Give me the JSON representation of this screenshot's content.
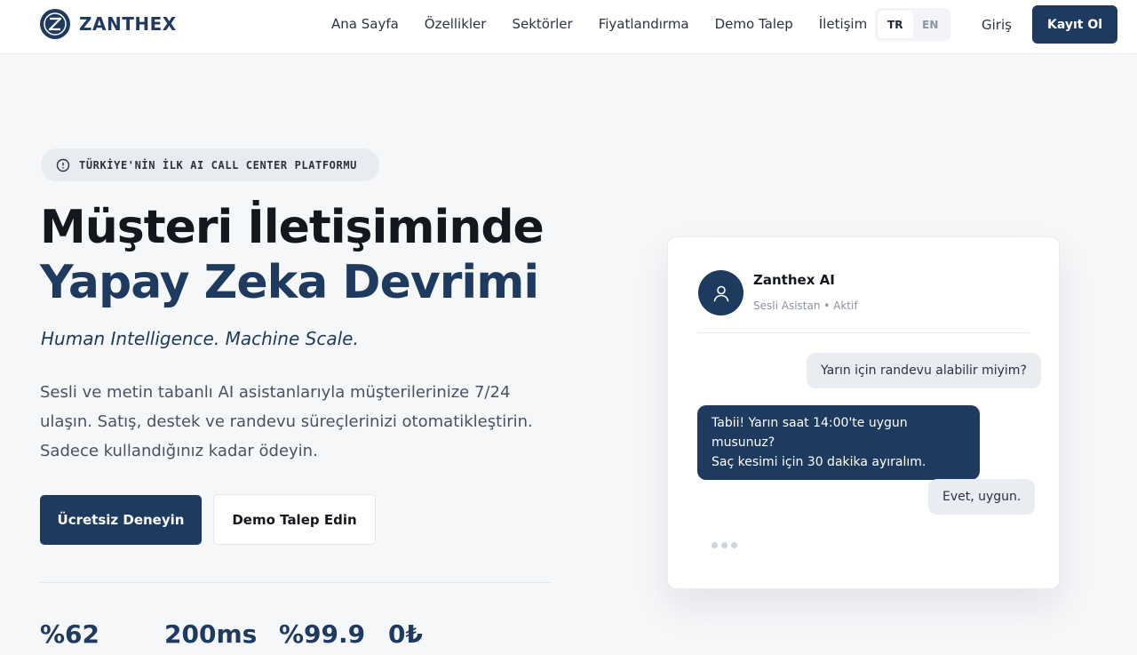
{
  "header": {
    "brand": "ZANTHEX",
    "nav": [
      "Ana Sayfa",
      "Özellikler",
      "Sektörler",
      "Fiyatlandırma",
      "Demo Talep",
      "İletişim"
    ],
    "lang": {
      "active": "TR",
      "inactive": "EN"
    },
    "login": "Giriş",
    "signup": "Kayıt Ol"
  },
  "hero": {
    "badge": "TÜRKİYE'NİN İLK AI CALL CENTER PLATFORMU",
    "title_line1": "Müşteri İletişiminde",
    "title_line2": "Yapay Zeka Devrimi",
    "tagline": "Human Intelligence. Machine Scale.",
    "description_lines": [
      "Sesli ve metin tabanlı AI asistanlarıyla müşterilerinize 7/24",
      "ulaşın. Satış, destek ve randevu süreçlerinizi otomatikleştirin.",
      "Sadece kullandığınız kadar ödeyin."
    ],
    "cta_primary": "Ücretsiz Deneyin",
    "cta_secondary": "Demo Talep Edin",
    "stats": [
      "%62",
      "200ms",
      "%99.9",
      "0₺"
    ]
  },
  "chat": {
    "agent_name": "Zanthex AI",
    "agent_status": "Sesli Asistan • Aktif",
    "messages": [
      {
        "from": "user",
        "text": "Yarın için randevu alabilir miyim?"
      },
      {
        "from": "bot",
        "lines": [
          "Tabii! Yarın saat 14:00'te uygun musunuz?",
          "Saç kesimi için 30 dakika ayıralım."
        ]
      },
      {
        "from": "user",
        "text": "Evet, uygun."
      }
    ]
  },
  "colors": {
    "brand": "#1f3a5f",
    "background": "#f5f7f9",
    "user_bubble": "#e9ecf0"
  }
}
